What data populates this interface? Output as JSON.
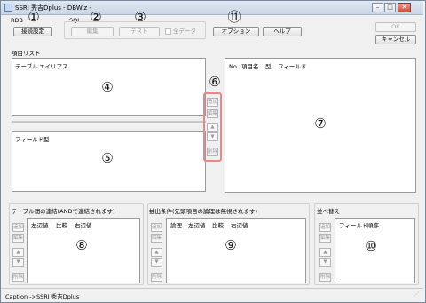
{
  "window": {
    "title": "SSRI 秀吉Dplus - DBWiz -",
    "minimize": "0",
    "maximize": "1",
    "close": "r"
  },
  "toolbar": {
    "rdb_label": "RDB",
    "connection_settings": "接続設定",
    "sql_label": "SQL",
    "edit": "編集",
    "test": "テスト",
    "all_data_label": "全データ",
    "options": "オプション",
    "help": "ヘルプ",
    "ok": "OK",
    "cancel": "キャンセル"
  },
  "markers": [
    "①",
    "②",
    "③",
    "④",
    "⑤",
    "⑥",
    "⑦",
    "⑧",
    "⑨",
    "⑩",
    "⑪"
  ],
  "item_list": {
    "label": "項目リスト",
    "tables_headers": [
      "テーブル",
      "エイリアス"
    ],
    "fields_headers": [
      "フィールド",
      "型"
    ]
  },
  "side_buttons": {
    "add": "追加",
    "edit": "編集",
    "up": "▲",
    "down": "▼",
    "delete": "削除"
  },
  "selected_fields": {
    "headers": [
      "No",
      "項目名",
      "型",
      "フィールド"
    ]
  },
  "join": {
    "label": "テーブル間の連結(ANDで連結されます)",
    "headers": [
      "左辺値",
      "比較",
      "右辺値"
    ]
  },
  "conditions": {
    "label": "抽出条件(先頭項目の論理は無視されます)",
    "headers": [
      "論理",
      "左辺値",
      "比較",
      "右辺値"
    ]
  },
  "sort": {
    "label": "並べ替え",
    "headers": [
      "フィールド",
      "順序"
    ]
  },
  "status": {
    "text": "Caption ->SSRI 秀吉Dplus"
  }
}
